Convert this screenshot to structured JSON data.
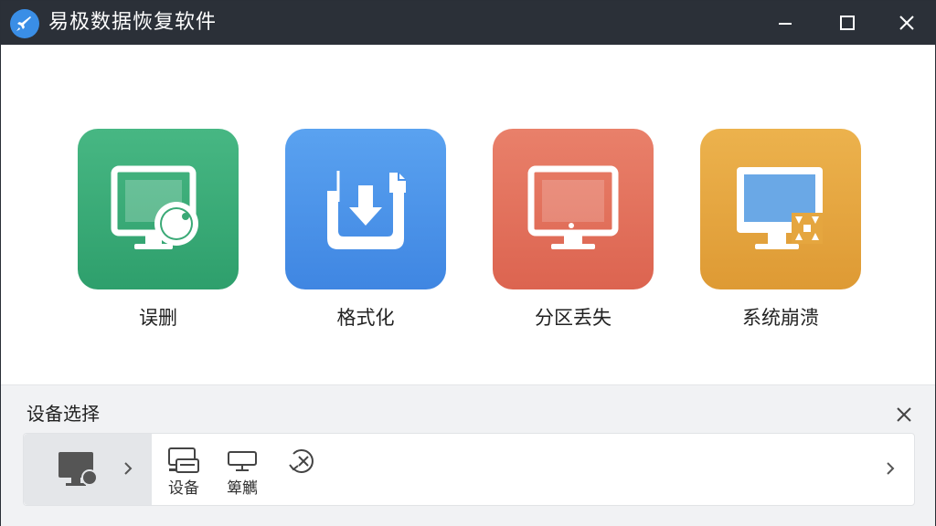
{
  "app": {
    "title": "易极数据恢复软件",
    "icons": {
      "logo": "rocket-icon",
      "minimize": "minimize-icon",
      "maximize": "maximize-icon",
      "close": "close-icon"
    }
  },
  "recovery_modes": [
    {
      "label": "误删",
      "icon": "monitor-mouse-icon",
      "color": "#3aa976"
    },
    {
      "label": "格式化",
      "icon": "format-download-icon",
      "color": "#4a91e8"
    },
    {
      "label": "分区丢失",
      "icon": "monitor-icon",
      "color": "#e16f59"
    },
    {
      "label": "系统崩溃",
      "icon": "monitor-crash-icon",
      "color": "#e5a63f"
    }
  ],
  "device_panel": {
    "title": "设备选择",
    "close_icon": "close-icon",
    "selected_icon": "computer-icon",
    "items": [
      {
        "label": "设备",
        "icon": "device-icon"
      },
      {
        "label": "箄觽",
        "icon": "monitor-outline-icon"
      },
      {
        "label": "",
        "icon": "cancel-history-icon"
      }
    ],
    "arrows": {
      "left": "chevron-right-icon",
      "right": "chevron-right-icon"
    }
  }
}
